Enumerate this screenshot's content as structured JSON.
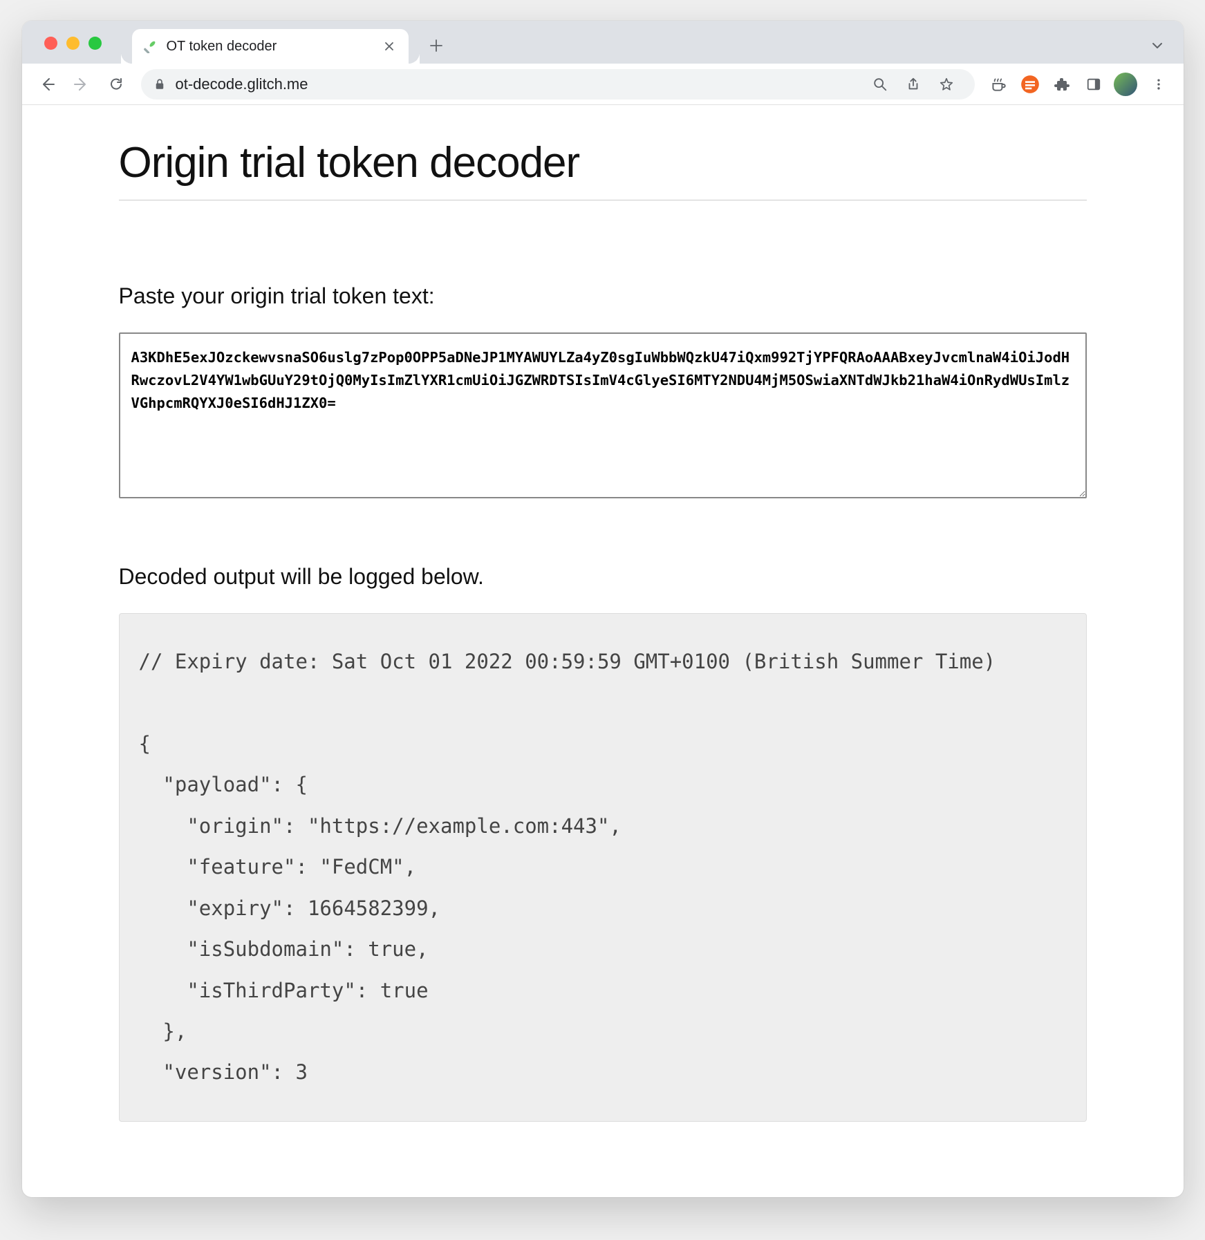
{
  "browser": {
    "tab_title": "OT token decoder",
    "url": "ot-decode.glitch.me"
  },
  "page": {
    "title": "Origin trial token decoder",
    "paste_heading": "Paste your origin trial token text:",
    "token_value": "A3KDhE5exJOzckewvsnaSO6uslg7zPop0OPP5aDNeJP1MYAWUYLZa4yZ0sgIuWbbWQzkU47iQxm992TjYPFQRAoAAABxeyJvcmlnaW4iOiJodHRwczovL2V4YW1wbGUuY29tOjQ0MyIsImZlYXR1cmUiOiJGZWRDTSIsImV4cGlyeSI6MTY2NDU4MjM5OSwiaXNTdWJkb21haW4iOnRydWUsImlzVGhpcmRQYXJ0eSI6dHJ1ZX0=",
    "output_heading": "Decoded output will be logged below.",
    "output_text": "// Expiry date: Sat Oct 01 2022 00:59:59 GMT+0100 (British Summer Time)\n\n{\n  \"payload\": {\n    \"origin\": \"https://example.com:443\",\n    \"feature\": \"FedCM\",\n    \"expiry\": 1664582399,\n    \"isSubdomain\": true,\n    \"isThirdParty\": true\n  },\n  \"version\": 3"
  },
  "decoded": {
    "expiry_date_comment": "Sat Oct 01 2022 00:59:59 GMT+0100 (British Summer Time)",
    "payload": {
      "origin": "https://example.com:443",
      "feature": "FedCM",
      "expiry": 1664582399,
      "isSubdomain": true,
      "isThirdParty": true
    },
    "version": 3
  }
}
